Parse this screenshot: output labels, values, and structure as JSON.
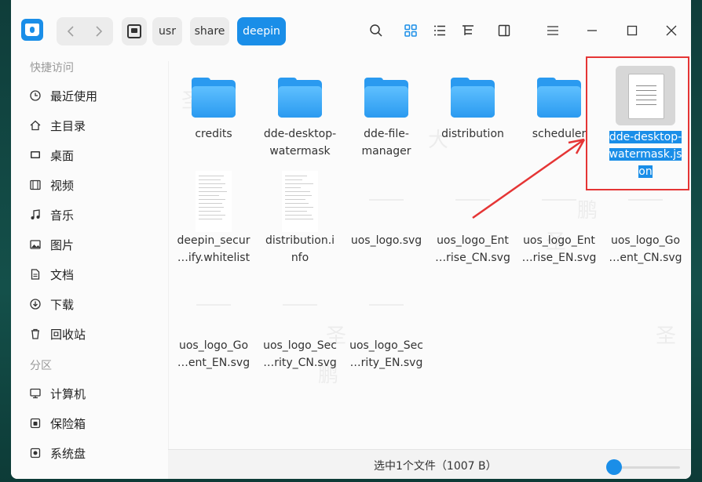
{
  "toolbar": {
    "breadcrumbs": [
      "usr",
      "share",
      "deepin"
    ],
    "icons": [
      "search-icon",
      "icon-view-icon",
      "list-view-icon",
      "tree-view-icon",
      "detail-panel-icon",
      "menu-icon",
      "minimize-icon",
      "maximize-icon",
      "close-icon"
    ]
  },
  "sidebar": {
    "quick_access_heading": "快捷访问",
    "items": [
      {
        "label": "最近使用",
        "icon": "clock-icon"
      },
      {
        "label": "主目录",
        "icon": "home-icon"
      },
      {
        "label": "桌面",
        "icon": "desktop-icon"
      },
      {
        "label": "视频",
        "icon": "video-icon"
      },
      {
        "label": "音乐",
        "icon": "music-icon"
      },
      {
        "label": "图片",
        "icon": "picture-icon"
      },
      {
        "label": "文档",
        "icon": "document-icon"
      },
      {
        "label": "下载",
        "icon": "download-icon"
      },
      {
        "label": "回收站",
        "icon": "trash-icon"
      }
    ],
    "partitions_heading": "分区",
    "partitions": [
      {
        "label": "计算机",
        "icon": "computer-icon"
      },
      {
        "label": "保险箱",
        "icon": "vault-icon"
      },
      {
        "label": "系统盘",
        "icon": "disk-icon"
      }
    ]
  },
  "files": {
    "row1": [
      {
        "l1": "credits",
        "l2": ""
      },
      {
        "l1": "dde-desktop-",
        "l2": "watermask"
      },
      {
        "l1": "dde-file-",
        "l2": "manager"
      },
      {
        "l1": "distribution",
        "l2": ""
      },
      {
        "l1": "scheduler",
        "l2": ""
      }
    ],
    "selected": {
      "l1": "dde-desktop-",
      "l2": "watermask.js",
      "l3": "on"
    },
    "row2": [
      {
        "l1": "deepin_secur",
        "l2": "…ify.whitelist"
      },
      {
        "l1": "distribution.i",
        "l2": "nfo"
      },
      {
        "l1": "uos_logo.svg",
        "l2": ""
      },
      {
        "l1": "uos_logo_Ent",
        "l2": "…rise_CN.svg"
      },
      {
        "l1": "uos_logo_Ent",
        "l2": "…rise_EN.svg"
      },
      {
        "l1": "uos_logo_Go",
        "l2": "…ent_CN.svg"
      }
    ],
    "row3": [
      {
        "l1": "uos_logo_Go",
        "l2": "…ent_EN.svg"
      },
      {
        "l1": "uos_logo_Sec",
        "l2": "…rity_CN.svg"
      },
      {
        "l1": "uos_logo_Sec",
        "l2": "…rity_EN.svg"
      }
    ]
  },
  "status": {
    "text": "选中1个文件（1007 B）"
  },
  "colors": {
    "accent": "#1a8ee8",
    "annotation": "#e53535"
  }
}
